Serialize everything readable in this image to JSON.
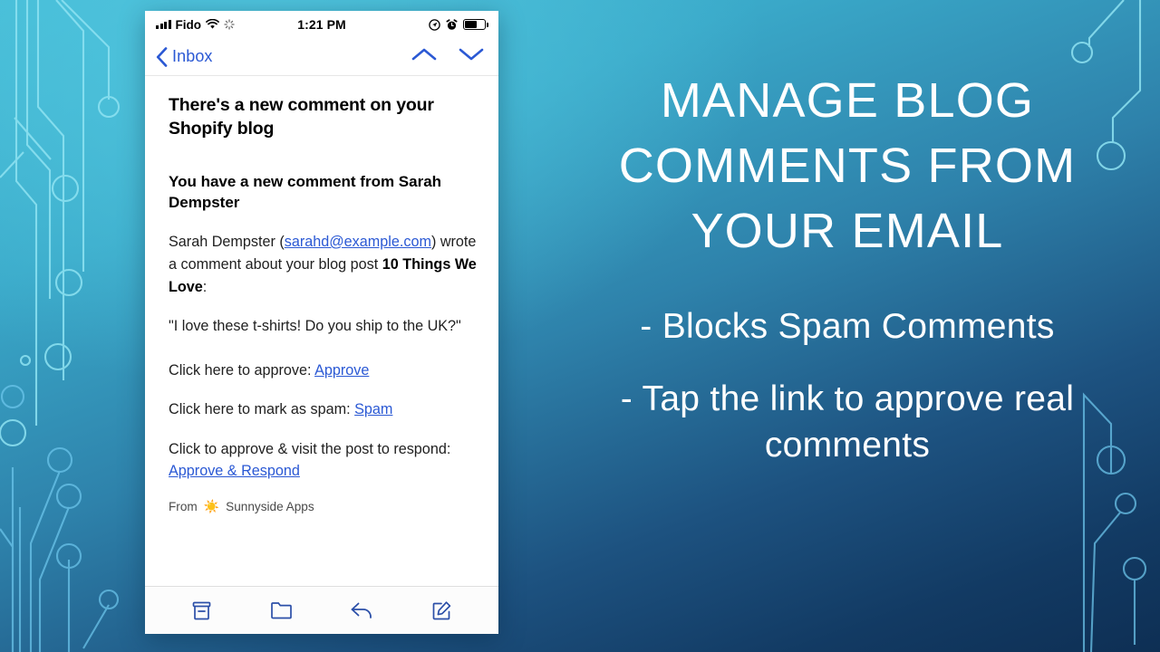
{
  "background": {
    "accent_light": "#4fc4dd",
    "accent_dark": "#0e2f54",
    "circuit_stroke": "#8fe3f2"
  },
  "phone": {
    "statusbar": {
      "signal_icon": "signal-bars-icon",
      "carrier": "Fido",
      "wifi_icon": "wifi-icon",
      "sync_icon": "sync-spinner-icon",
      "time": "1:21 PM",
      "location_icon": "location-arrow-icon",
      "alarm_icon": "alarm-clock-icon",
      "battery_icon": "battery-icon",
      "battery_level": 62
    },
    "navbar": {
      "back_label": "Inbox",
      "back_icon": "chevron-left-icon",
      "prev_icon": "chevron-up-icon",
      "next_icon": "chevron-down-icon"
    },
    "email": {
      "subject": "There's a new comment on your Shopify blog",
      "greeting": "You have a new comment from Sarah Dempster",
      "intro": {
        "sender_name": "Sarah Dempster",
        "open_paren": " (",
        "sender_email": "sarahd@example.com",
        "close_paren": ") ",
        "middle": "wrote a comment about your blog post ",
        "post_title": "10 Things We Love",
        "colon": ":"
      },
      "comment": "\"I love these t-shirts! Do you ship to the UK?\"",
      "actions": [
        {
          "label": "Click here to approve: ",
          "link": "Approve"
        },
        {
          "label": "Click here to mark as spam: ",
          "link": "Spam"
        },
        {
          "label": "Click to approve & visit the post to respond: ",
          "link": "Approve & Respond"
        }
      ],
      "from_prefix": "From",
      "from_emoji": "☀️",
      "from_name": "Sunnyside Apps",
      "link_color": "#2b59d4"
    },
    "toolbar": {
      "items": [
        {
          "name": "archive-icon",
          "label": "Archive"
        },
        {
          "name": "folder-icon",
          "label": "Move to folder"
        },
        {
          "name": "reply-icon",
          "label": "Reply"
        },
        {
          "name": "compose-icon",
          "label": "Compose"
        }
      ],
      "tint": "#2b4fa8"
    }
  },
  "promo": {
    "headline": "Manage blog comments from your email",
    "bullets": [
      "- Blocks Spam Comments",
      "- Tap the link to approve real comments"
    ]
  }
}
